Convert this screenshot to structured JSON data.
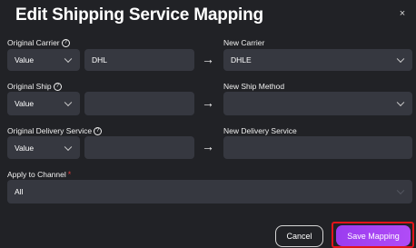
{
  "modal": {
    "title": "Edit Shipping Service Mapping",
    "close_glyph": "×"
  },
  "rows": [
    {
      "original_label": "Original Carrier",
      "match_type": "Value",
      "original_value": "DHL",
      "new_label": "New Carrier",
      "new_value": "DHLE",
      "new_has_dropdown": true
    },
    {
      "original_label": "Original Ship",
      "match_type": "Value",
      "original_value": "",
      "new_label": "New Ship Method",
      "new_value": "",
      "new_has_dropdown": true
    },
    {
      "original_label": "Original Delivery Service",
      "match_type": "Value",
      "original_value": "",
      "new_label": "New Delivery Service",
      "new_value": "",
      "new_has_dropdown": false
    }
  ],
  "channel": {
    "label": "Apply to Channel",
    "required_mark": "*",
    "value": "All"
  },
  "buttons": {
    "cancel": "Cancel",
    "save": "Save Mapping"
  },
  "icons": {
    "help": "?",
    "arrow": "→"
  },
  "colors": {
    "background": "#212226",
    "field": "#363840",
    "accent": "#a446f4",
    "highlight_border": "#e2141a",
    "required": "#e03b3b"
  }
}
